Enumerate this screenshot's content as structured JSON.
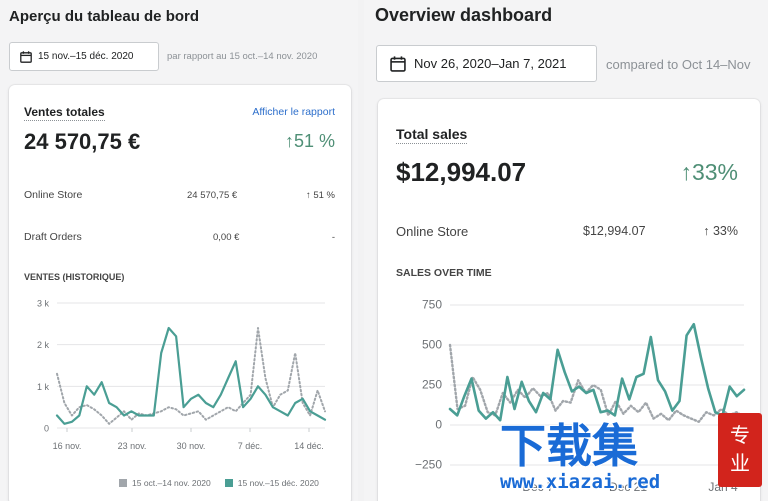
{
  "left": {
    "title": "Aperçu du tableau de bord",
    "date_range": "15 nov.–15 déc. 2020",
    "comparison": "par rapport au 15 oct.–14 nov. 2020",
    "card": {
      "title": "Ventes totales",
      "link": "Afficher le rapport",
      "total": "24 570,75 €",
      "change": "51 %",
      "rows": [
        {
          "label": "Online Store",
          "value": "24 570,75 €",
          "change": "51 %"
        },
        {
          "label": "Draft Orders",
          "value": "0,00 €",
          "change": "-"
        }
      ],
      "chart_title": "VENTES (HISTORIQUE)",
      "legend": [
        "15 oct.–14 nov. 2020",
        "15 nov.–15 déc. 2020"
      ]
    }
  },
  "right": {
    "title": "Overview dashboard",
    "date_range": "Nov 26, 2020–Jan 7, 2021",
    "comparison": "compared to Oct 14–Nov",
    "card": {
      "title": "Total sales",
      "total": "$12,994.07",
      "change": "33%",
      "rows": [
        {
          "label": "Online Store",
          "value": "$12,994.07",
          "change": "33%"
        }
      ],
      "chart_title": "SALES OVER TIME"
    }
  },
  "watermark": {
    "cn": "下载集",
    "badge": "专业",
    "url": "www.xiazai.red"
  },
  "icons": {
    "calendar": "calendar-icon",
    "arrow": "arrow-up-icon"
  },
  "colors": {
    "current": "#4a9e94",
    "previous": "#a1a6ab",
    "up": "#4f8f76",
    "link": "#2c6ecb",
    "watermark": "#1a6bd6"
  },
  "chart_data": [
    {
      "type": "line",
      "title": "VENTES (HISTORIQUE)",
      "xlabel": "",
      "ylabel": "",
      "x_tick_labels": [
        "16 nov.",
        "23 nov.",
        "30 nov.",
        "7 déc.",
        "14 déc."
      ],
      "y_tick_labels": [
        "0",
        "1 k",
        "2 k",
        "3 k"
      ],
      "ylim": [
        0,
        3000
      ],
      "grid": true,
      "legend_position": "bottom",
      "series": [
        {
          "name": "15 oct.–14 nov. 2020",
          "style": "dotted",
          "values": [
            1300,
            600,
            300,
            500,
            550,
            450,
            300,
            100,
            250,
            400,
            200,
            350,
            300,
            350,
            400,
            500,
            450,
            300,
            350,
            400,
            200,
            300,
            400,
            500,
            400,
            600,
            800,
            2400,
            1200,
            500,
            800,
            900,
            1800,
            600,
            300,
            900,
            400
          ]
        },
        {
          "name": "15 nov.–15 déc. 2020",
          "style": "solid",
          "values": [
            300,
            100,
            150,
            300,
            1000,
            800,
            1100,
            600,
            500,
            300,
            400,
            300,
            300,
            300,
            1800,
            2400,
            2200,
            500,
            700,
            800,
            600,
            500,
            800,
            1200,
            1600,
            500,
            700,
            1000,
            800,
            500,
            400,
            300,
            600,
            700,
            400,
            300,
            200
          ]
        }
      ]
    },
    {
      "type": "line",
      "title": "SALES OVER TIME",
      "xlabel": "",
      "ylabel": "",
      "x_tick_labels": [
        "Dec 7",
        "Dec 21",
        "Jan 4"
      ],
      "y_tick_labels": [
        "−250",
        "0",
        "250",
        "500",
        "750"
      ],
      "ylim": [
        -250,
        750
      ],
      "grid": true,
      "series": [
        {
          "style": "dotted",
          "values": [
            500,
            100,
            120,
            300,
            220,
            80,
            60,
            200,
            140,
            220,
            170,
            230,
            180,
            200,
            90,
            150,
            140,
            280,
            200,
            250,
            220,
            60,
            150,
            70,
            120,
            80,
            140,
            40,
            70,
            30,
            90,
            60,
            40,
            20,
            80,
            60,
            100,
            60,
            80,
            50
          ]
        },
        {
          "style": "solid",
          "values": [
            100,
            60,
            180,
            290,
            90,
            40,
            80,
            30,
            300,
            100,
            270,
            150,
            80,
            200,
            160,
            470,
            330,
            210,
            240,
            200,
            220,
            80,
            90,
            60,
            290,
            160,
            300,
            320,
            550,
            280,
            210,
            90,
            150,
            560,
            630,
            420,
            230,
            80,
            60,
            240,
            180,
            220
          ]
        }
      ]
    }
  ]
}
